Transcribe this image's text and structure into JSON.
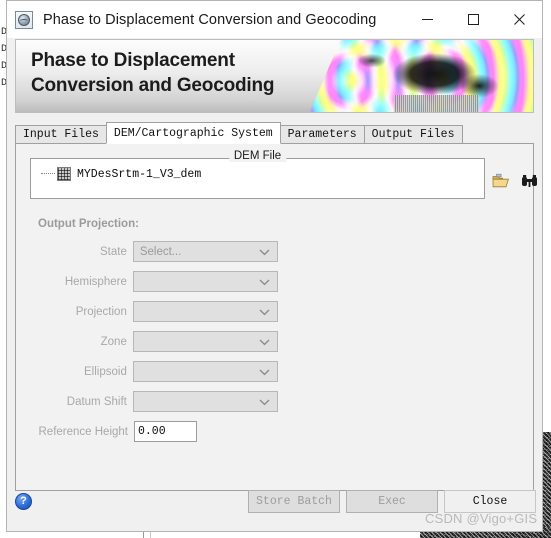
{
  "window": {
    "title": "Phase to Displacement Conversion and Geocoding",
    "app_icon": "globe-app-icon",
    "minimize_label": "—",
    "maximize_label": "□",
    "close_label": "✕"
  },
  "banner": {
    "title": "Phase to Displacement\nConversion and Geocoding",
    "image_alt": "interferogram-fringe-image"
  },
  "tabs": [
    {
      "label": "Input Files",
      "active": false
    },
    {
      "label": "DEM/Cartographic System",
      "active": true
    },
    {
      "label": "Parameters",
      "active": false
    },
    {
      "label": "Output Files",
      "active": false
    }
  ],
  "dem_group": {
    "legend": "DEM File",
    "files": [
      {
        "name": "MYDesSrtm-1_V3_dem",
        "icon": "raster-file-icon"
      }
    ],
    "browse_icon": "open-folder-icon",
    "search_icon": "binoculars-icon"
  },
  "output_projection": {
    "section_label": "Output Projection:",
    "fields": [
      {
        "label": "State",
        "value": "Select...",
        "type": "combo",
        "disabled": true
      },
      {
        "label": "Hemisphere",
        "value": "",
        "type": "combo",
        "disabled": true
      },
      {
        "label": "Projection",
        "value": "",
        "type": "combo",
        "disabled": true
      },
      {
        "label": "Zone",
        "value": "",
        "type": "combo",
        "disabled": true
      },
      {
        "label": "Ellipsoid",
        "value": "",
        "type": "combo",
        "disabled": true
      },
      {
        "label": "Datum Shift",
        "value": "",
        "type": "combo",
        "disabled": true
      },
      {
        "label": "Reference Height",
        "value": "0.00",
        "type": "text",
        "disabled": false
      }
    ]
  },
  "footer": {
    "help_label": "?",
    "store_batch_label": "Store Batch",
    "exec_label": "Exec",
    "close_label": "Close"
  },
  "watermark": {
    "text": "CSDN @Vigo+GIS"
  },
  "background": {
    "edge_letters": "D\nD\nD\nD"
  },
  "colors": {
    "window_bg": "#f0f0f0",
    "panel_bg": "#f2f2f2",
    "field_bg": "#ffffff",
    "disabled_text": "#a8a8a8",
    "accent_help": "#2f6ddb",
    "border": "#a0a0a0"
  }
}
